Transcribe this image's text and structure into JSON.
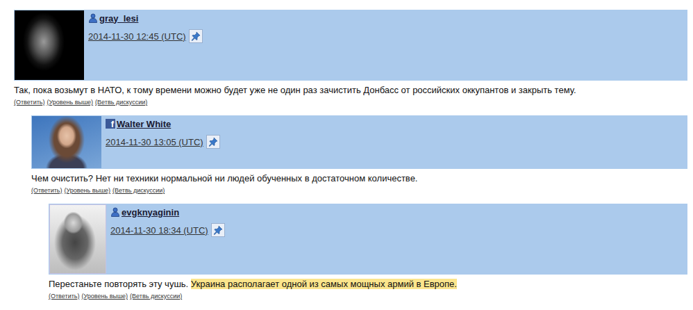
{
  "comments": [
    {
      "user": {
        "name": "gray_lesi",
        "kind": "lj-user"
      },
      "time": "2014-11-30 12:45 (UTC)",
      "body": [
        {
          "text": "Так, пока возьмут в НАТО, к тому времени можно будет уже не один раз зачистить Донбасс от российских оккупантов и закрыть тему.",
          "highlighted": false
        }
      ],
      "links": [
        "(Ответить)",
        "(Уровень выше)",
        "(Ветвь дискуссии)"
      ],
      "replies": [
        {
          "user": {
            "name": "Walter White",
            "kind": "facebook",
            "icon": "f"
          },
          "time": "2014-11-30 13:05 (UTC)",
          "body": [
            {
              "text": "Чем очистить? Нет ни техники нормальной ни людей обученных в достаточном количестве.",
              "highlighted": false
            }
          ],
          "links": [
            "(Ответить)",
            "(Уровень выше)",
            "(Ветвь дискуссии)"
          ],
          "replies": [
            {
              "user": {
                "name": "evgknyaginin",
                "kind": "lj-user"
              },
              "time": "2014-11-30 18:34 (UTC)",
              "body": [
                {
                  "text": "Перестаньте повторять эту чушь. ",
                  "highlighted": false
                },
                {
                  "text": "Украина располагает одной из самых мощных армий в Европе.",
                  "highlighted": true
                }
              ],
              "links": [
                "(Ответить)",
                "(Уровень выше)",
                "(Ветвь дискуссии)"
              ],
              "replies": []
            }
          ]
        }
      ]
    }
  ]
}
